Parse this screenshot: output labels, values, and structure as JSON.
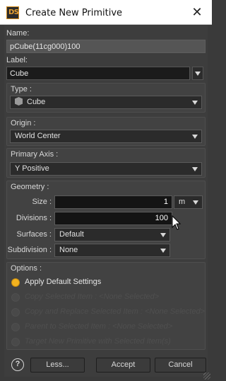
{
  "window": {
    "title": "Create New Primitive",
    "app_badge": "DS"
  },
  "name": {
    "label": "Name:",
    "value": "pCube(11cg000)100"
  },
  "label_section": {
    "label": "Label:",
    "value": "Cube"
  },
  "type": {
    "title": "Type :",
    "value": "Cube"
  },
  "origin": {
    "title": "Origin :",
    "value": "World Center"
  },
  "primary_axis": {
    "title": "Primary Axis :",
    "value": "Y Positive"
  },
  "geometry": {
    "title": "Geometry :",
    "size_label": "Size :",
    "size_value": "1",
    "unit": "m",
    "divisions_label": "Divisions :",
    "divisions_value": "100",
    "surfaces_label": "Surfaces :",
    "surfaces_value": "Default",
    "subdivision_label": "Subdivision :",
    "subdivision_value": "None"
  },
  "options": {
    "title": "Options :",
    "items": [
      {
        "label": "Apply Default Settings"
      },
      {
        "label": "Copy Selected Item : <None Selected>"
      },
      {
        "label": "Copy and Replace Selected Item : <None Selected>"
      },
      {
        "label": "Parent to Selected Item : <None Selected>"
      },
      {
        "label": "Target New Primitive with Selected Item(s)"
      }
    ]
  },
  "footer": {
    "help": "?",
    "less": "Less...",
    "accept": "Accept",
    "cancel": "Cancel"
  }
}
